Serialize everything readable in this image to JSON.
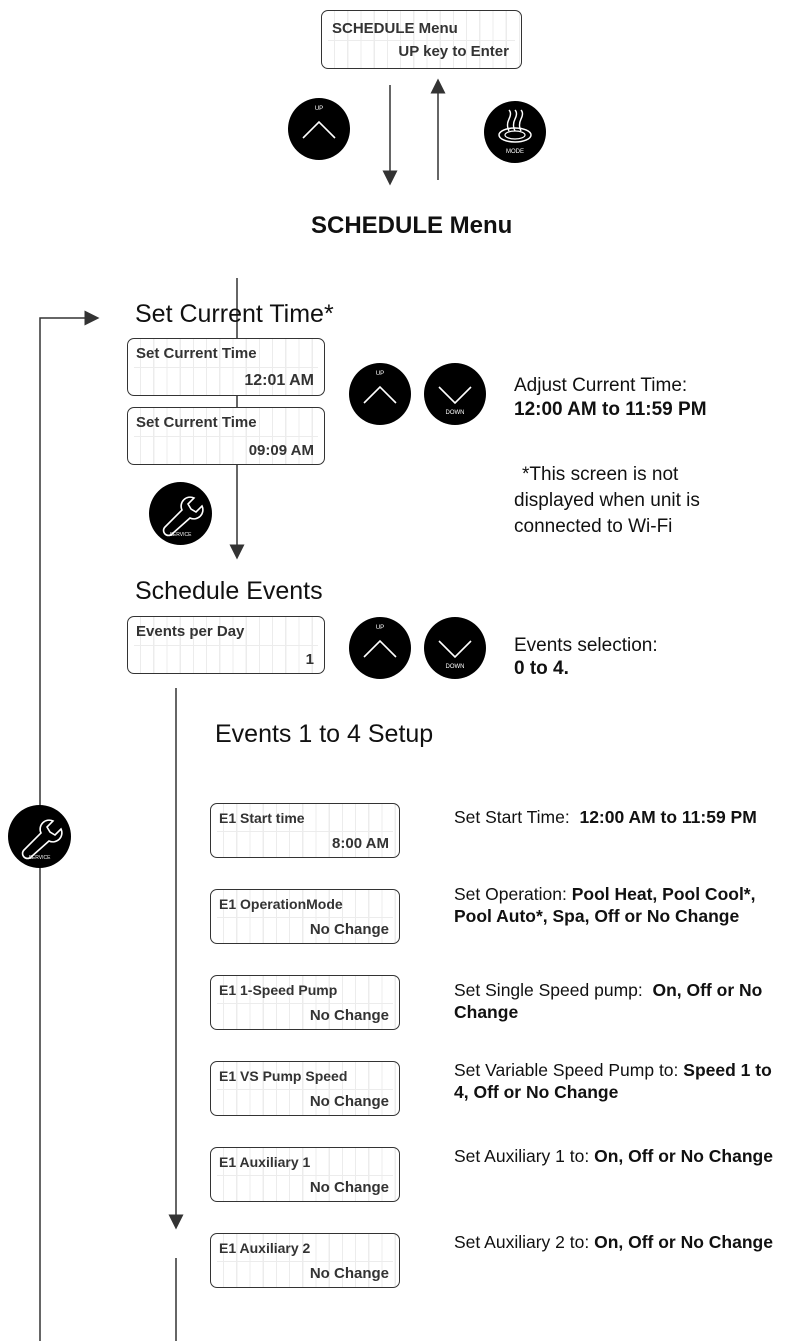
{
  "top_display": {
    "line1": "SCHEDULE  Menu",
    "line2": "UP key to Enter"
  },
  "menu_title": "SCHEDULE Menu",
  "buttons": {
    "up": "UP",
    "down": "DOWN",
    "mode": "MODE",
    "service": "SERVICE"
  },
  "set_time": {
    "heading": "Set Current Time*",
    "display1": {
      "line1": "Set Current  Time",
      "line2": "12:01 AM"
    },
    "display2": {
      "line1": "Set Current  Time",
      "line2": "09:09 AM"
    },
    "desc_line1": "Adjust Current Time:",
    "desc_line2": "12:00 AM to 11:59 PM",
    "note1": "*This screen is not",
    "note2": "displayed when unit is",
    "note3": "connected to Wi-Fi"
  },
  "schedule_events": {
    "heading": "Schedule Events",
    "display": {
      "line1": "Events  per  Day",
      "line2": "1"
    },
    "desc_line1": "Events selection:",
    "desc_line2": "0 to 4."
  },
  "events_setup": {
    "heading": "Events 1 to 4 Setup",
    "rows": [
      {
        "line1": "E1 Start time",
        "line2": "8:00 AM",
        "desc_plain": "Set Start Time:  ",
        "desc_bold": "12:00 AM to 11:59 PM"
      },
      {
        "line1": "E1 OperationMode",
        "line2": "No Change",
        "desc_plain": "Set Operation: ",
        "desc_bold": "Pool Heat, Pool Cool*, Pool Auto*, Spa, Off or No Change"
      },
      {
        "line1": "E1 1-Speed Pump",
        "line2": "No Change",
        "desc_plain": "Set Single Speed pump:  ",
        "desc_bold": "On, Off or No Change"
      },
      {
        "line1": "E1 VS Pump Speed",
        "line2": "No Change",
        "desc_plain": "Set Variable Speed Pump to: ",
        "desc_bold": "Speed 1 to 4, Off or No Change"
      },
      {
        "line1": "E1  Auxiliary 1",
        "line2": "No Change",
        "desc_plain": "Set Auxiliary 1 to: ",
        "desc_bold": "On, Off or No Change"
      },
      {
        "line1": "E1  Auxiliary 2",
        "line2": "No Change",
        "desc_plain": "Set Auxiliary 2 to: ",
        "desc_bold": "On, Off or No Change"
      }
    ]
  }
}
